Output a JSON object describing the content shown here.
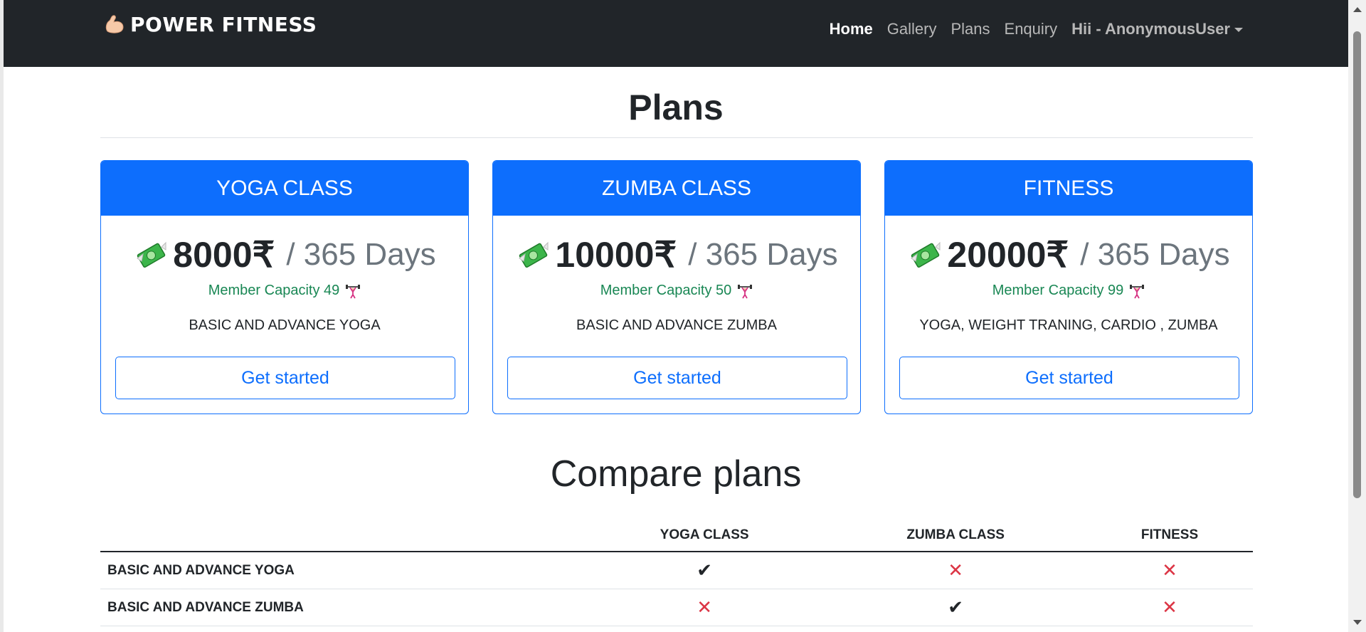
{
  "navbar": {
    "brand": "POWER FITNESS",
    "brand_icon": "flexed-biceps-icon",
    "links": [
      {
        "label": "Home",
        "active": true
      },
      {
        "label": "Gallery",
        "active": false
      },
      {
        "label": "Plans",
        "active": false
      },
      {
        "label": "Enquiry",
        "active": false
      }
    ],
    "user_menu": "Hii - AnonymousUser"
  },
  "page": {
    "title": "Plans"
  },
  "plans": [
    {
      "name": "YOGA CLASS",
      "price": "8000₹",
      "period": "/ 365 Days",
      "capacity": "Member Capacity 49",
      "description": "BASIC AND ADVANCE YOGA",
      "button": "Get started"
    },
    {
      "name": "ZUMBA CLASS",
      "price": "10000₹",
      "period": "/ 365 Days",
      "capacity": "Member Capacity 50",
      "description": "BASIC AND ADVANCE ZUMBA",
      "button": "Get started"
    },
    {
      "name": "FITNESS",
      "price": "20000₹",
      "period": "/ 365 Days",
      "capacity": "Member Capacity 99",
      "description": "YOGA, WEIGHT TRANING, CARDIO , ZUMBA",
      "button": "Get started"
    }
  ],
  "compare": {
    "title": "Compare plans",
    "headers": [
      "",
      "YOGA CLASS",
      "ZUMBA CLASS",
      "FITNESS"
    ],
    "rows": [
      {
        "feature": "BASIC AND ADVANCE YOGA",
        "values": [
          true,
          false,
          false
        ]
      },
      {
        "feature": "BASIC AND ADVANCE ZUMBA",
        "values": [
          false,
          true,
          false
        ]
      }
    ]
  },
  "colors": {
    "navbar": "#212529",
    "primary": "#0d6efd",
    "success": "#198754",
    "danger": "#dc3545"
  },
  "icons": {
    "check": "check-icon",
    "cross": "cross-icon",
    "money": "money-with-wings-icon",
    "weightlifter": "weightlifter-icon"
  }
}
